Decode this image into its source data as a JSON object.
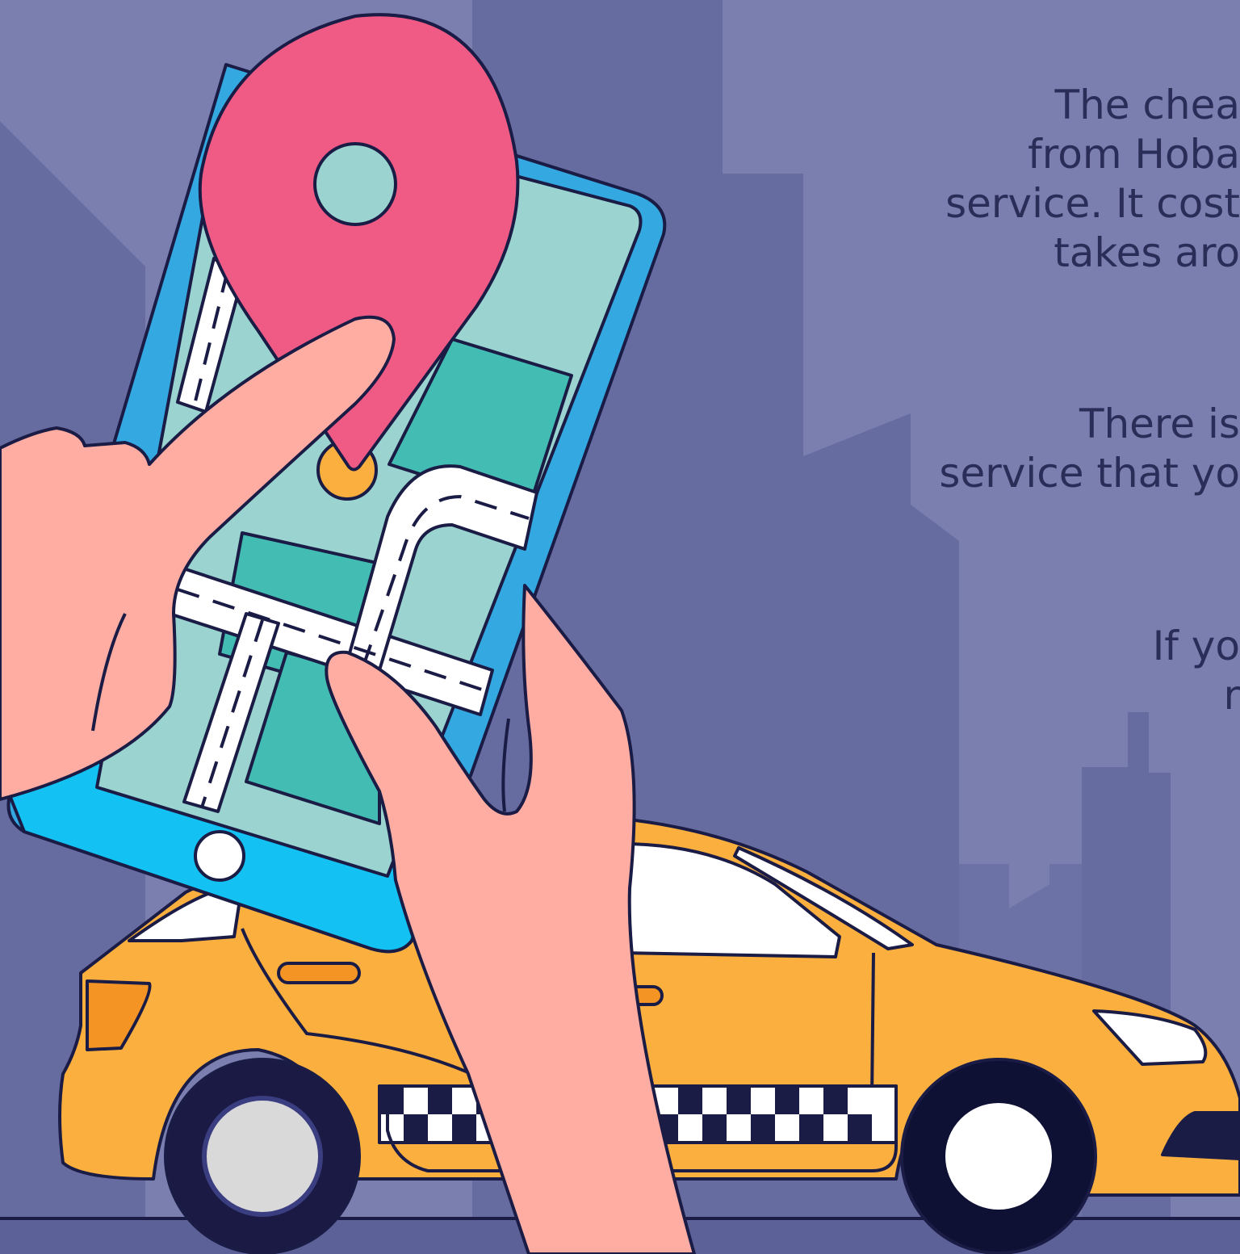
{
  "colors": {
    "background": "#7a7fb0",
    "building": "#666ba0",
    "ground": "#5c6198",
    "outline": "#1a1c45",
    "pin": "#ef5b85",
    "pin_dot": "#9ad3cf",
    "phone_frame": "#34a8e0",
    "phone_screen": "#9ad3cf",
    "map_block": "#43bdb3",
    "hand": "#ffada3",
    "taxi": "#faaf3f",
    "taxi_light": "#f39424",
    "tyre": "#1b1a44",
    "hubcap_left": "#d9d9d9",
    "hubcap_right": "#ffffff",
    "text": "#2a2d57"
  },
  "icons": [
    "map-pin-icon",
    "smartphone-icon",
    "taxi-icon",
    "hand-icon"
  ],
  "paragraphs": [
    {
      "lines": [
        "The chea",
        "from Hoba",
        "service. It cost",
        "takes aro"
      ]
    },
    {
      "lines": [
        "There is",
        "service that yo"
      ]
    },
    {
      "lines": [
        "If yo",
        "r"
      ]
    }
  ]
}
